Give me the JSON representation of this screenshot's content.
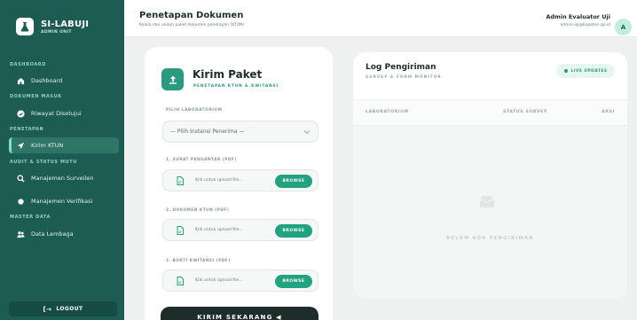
{
  "app": {
    "title": "SI-LABUJI",
    "subtitle": "ADMIN UNIT"
  },
  "sidebar": {
    "sections": [
      {
        "label": "DASHBOARD"
      },
      {
        "label": "DOKUMEN MASUK"
      },
      {
        "label": "PENETAPAN"
      },
      {
        "label": "AUDIT & STATUS MUTU"
      },
      {
        "label": "MASTER DATA"
      }
    ],
    "items": [
      {
        "label": "Dashboard",
        "icon": "home-icon"
      },
      {
        "label": "Riwayat Disetujui",
        "icon": "check-circle-icon"
      },
      {
        "label": "Kirim KTUN",
        "icon": "send-icon",
        "active": true
      },
      {
        "label": "Manajemen Surveilen",
        "icon": "search-icon"
      },
      {
        "label": "Manajemen Verifikasi",
        "icon": "dot-icon"
      },
      {
        "label": "Data Lembaga",
        "icon": "users-icon"
      }
    ],
    "logout_label": "LOGOUT"
  },
  "header": {
    "title": "Penetapan Dokumen",
    "subtitle": "Kelola dan unduh paket dokumen penetapan (KTUN)",
    "user_name": "Admin Evaluator Uji",
    "user_email": "admin.uji@bapeten.go.id",
    "avatar_initial": "A"
  },
  "form": {
    "title": "Kirim Paket",
    "subtitle": "PENETAPAN KTUN & KWITANSI",
    "lab_label": "PILIH LABORATORIUM",
    "lab_placeholder": "— Pilih Instansi Penerima —",
    "files": [
      {
        "label": "1. SURAT PENGANTAR (PDF)",
        "placeholder": "Klik untuk upload file...",
        "button": "BROWSE"
      },
      {
        "label": "2. DOKUMEN KTUN (PDF)",
        "placeholder": "Klik untuk upload file...",
        "button": "BROWSE"
      },
      {
        "label": "3. BUKTI KWITANSI (PDF)",
        "placeholder": "Klik untuk upload file...",
        "button": "BROWSE"
      }
    ],
    "submit_label": "KIRIM SEKARANG ◀"
  },
  "log": {
    "title": "Log Pengiriman",
    "subtitle": "SURVEY & FORM MONITOR",
    "live_label": "LIVE UPDATES",
    "columns": [
      "LABORATORIUM",
      "STATUS SURVEY",
      "AKSI"
    ],
    "empty_text": "BELUM ADA PENGIRIMAN"
  },
  "colors": {
    "sidebar": "#1d5c52",
    "accent": "#22a37f",
    "dark_button": "#1f2d2a"
  }
}
